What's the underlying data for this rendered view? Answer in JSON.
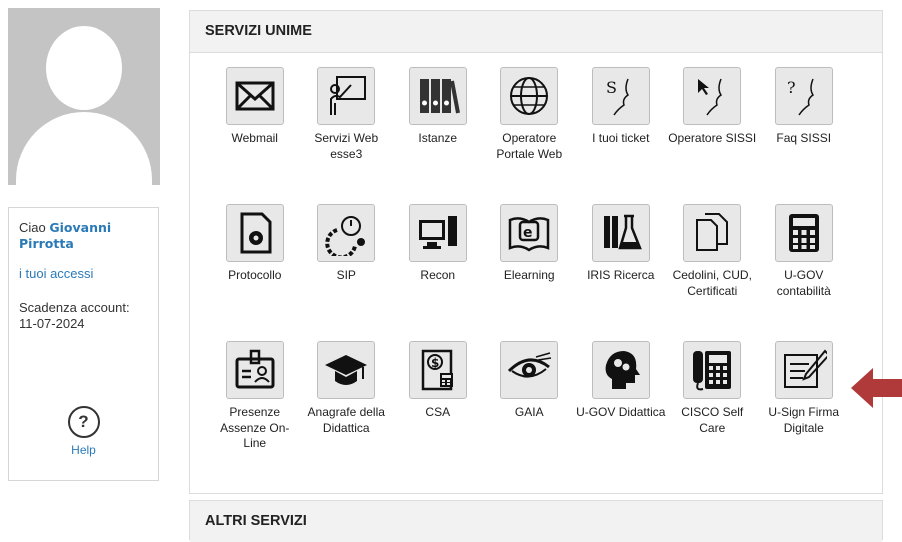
{
  "user": {
    "greeting": "Ciao",
    "name": "Giovanni Pirrotta",
    "access_link": "i tuoi accessi",
    "expiry_label": "Scadenza account:",
    "expiry_date": "11-07-2024",
    "help_label": "Help"
  },
  "services_panel": {
    "title": "SERVIZI UNIME",
    "tiles": [
      {
        "label": "Webmail",
        "icon": "envelope-icon"
      },
      {
        "label": "Servizi Web esse3",
        "icon": "teacher-board-icon"
      },
      {
        "label": "Istanze",
        "icon": "binders-icon"
      },
      {
        "label": "Operatore Portale Web",
        "icon": "globe-icon"
      },
      {
        "label": "I tuoi ticket",
        "icon": "ticket-s-icon"
      },
      {
        "label": "Operatore SISSI",
        "icon": "cursor-head-icon"
      },
      {
        "label": "Faq SISSI",
        "icon": "question-head-icon"
      },
      {
        "label": "Protocollo",
        "icon": "document-gear-icon"
      },
      {
        "label": "SIP",
        "icon": "stopwatch-gear-icon"
      },
      {
        "label": "Recon",
        "icon": "computer-icon"
      },
      {
        "label": "Elearning",
        "icon": "ebook-icon"
      },
      {
        "label": "IRIS Ricerca",
        "icon": "flask-icon"
      },
      {
        "label": "Cedolini, CUD, Certificati",
        "icon": "documents-icon"
      },
      {
        "label": "U-GOV contabilità",
        "icon": "calculator-icon"
      },
      {
        "label": "Presenze Assenze On-Line",
        "icon": "badge-icon"
      },
      {
        "label": "Anagrafe della Didattica",
        "icon": "graduation-cap-icon"
      },
      {
        "label": "CSA",
        "icon": "dollar-ledger-icon"
      },
      {
        "label": "GAIA",
        "icon": "eye-icon"
      },
      {
        "label": "U-GOV Didattica",
        "icon": "brain-head-icon"
      },
      {
        "label": "CISCO Self Care",
        "icon": "phone-icon"
      },
      {
        "label": "U-Sign Firma Digitale",
        "icon": "sign-document-icon"
      }
    ]
  },
  "other_panel": {
    "title": "ALTRI SERVIZI"
  },
  "colors": {
    "link": "#2a7ab8",
    "arrow": "#b03a3a",
    "tile_bg": "#e8e8e8"
  }
}
